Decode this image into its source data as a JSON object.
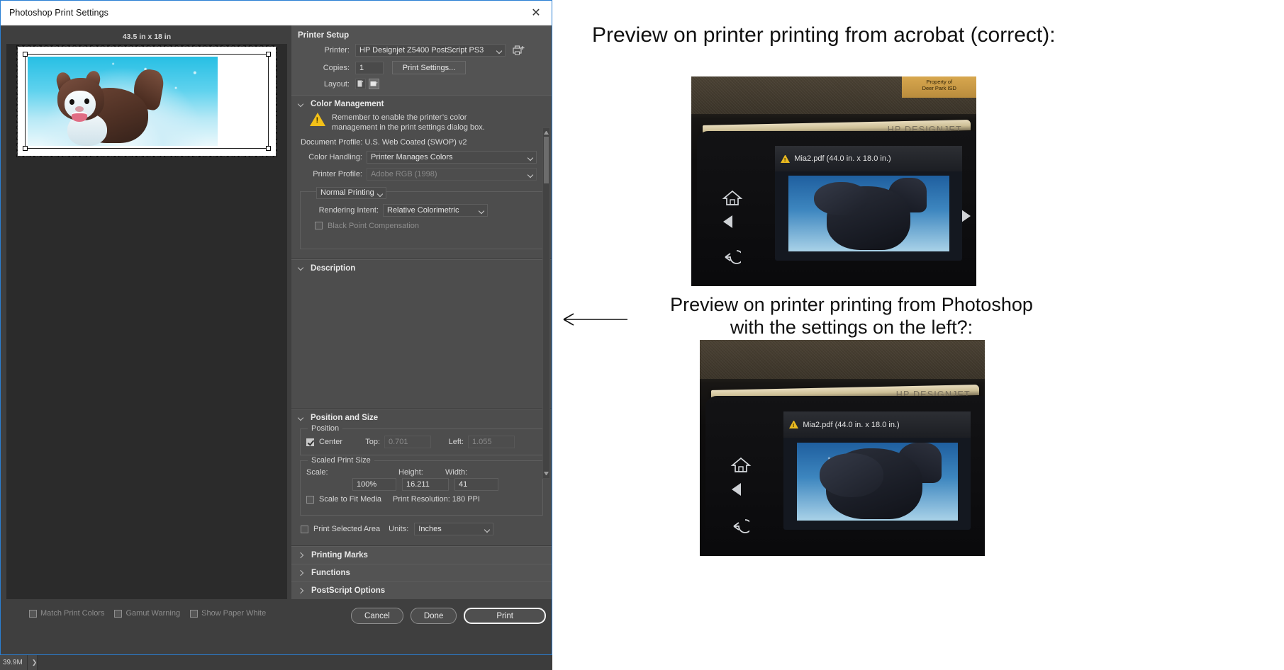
{
  "dialog": {
    "title": "Photoshop Print Settings",
    "close_icon": "close-icon"
  },
  "preview": {
    "size_label": "43.5 in x 18 in"
  },
  "printer_setup": {
    "heading": "Printer Setup",
    "printer_label": "Printer:",
    "printer_value": "HP Designjet Z5400 PostScript PS3",
    "printer_add_icon": "add-printer-icon",
    "copies_label": "Copies:",
    "copies_value": "1",
    "print_settings_button": "Print Settings...",
    "layout_label": "Layout:",
    "layout_portrait_icon": "portrait-orientation-icon",
    "layout_landscape_icon": "landscape-orientation-icon"
  },
  "color_management": {
    "heading": "Color Management",
    "warning_icon": "warning-triangle-icon",
    "warning_text_line1": "Remember to enable the printer’s color",
    "warning_text_line2": "management in the print settings dialog box.",
    "document_profile": "Document Profile: U.S. Web Coated (SWOP) v2",
    "color_handling_label": "Color Handling:",
    "color_handling_value": "Printer Manages Colors",
    "printer_profile_label": "Printer Profile:",
    "printer_profile_value": "Adobe RGB (1998)",
    "print_mode_value": "Normal Printing",
    "rendering_intent_label": "Rendering Intent:",
    "rendering_intent_value": "Relative Colorimetric",
    "black_point_label": "Black Point Compensation",
    "black_point_checked": false
  },
  "description": {
    "heading": "Description"
  },
  "position_size": {
    "heading": "Position and Size",
    "position_group": "Position",
    "center_label": "Center",
    "center_checked": true,
    "top_label": "Top:",
    "top_value": "0.701",
    "left_label": "Left:",
    "left_value": "1.055",
    "scaled_group": "Scaled Print Size",
    "scale_label": "Scale:",
    "scale_value": "100%",
    "height_label": "Height:",
    "height_value": "16.211",
    "width_label": "Width:",
    "width_value": "41",
    "scale_to_fit_label": "Scale to Fit Media",
    "scale_to_fit_checked": false,
    "print_resolution": "Print Resolution: 180 PPI",
    "print_selected_area_label": "Print Selected Area",
    "print_selected_area_checked": false,
    "units_label": "Units:",
    "units_value": "Inches"
  },
  "collapsed_sections": [
    {
      "label": "Printing Marks"
    },
    {
      "label": "Functions"
    },
    {
      "label": "PostScript Options"
    }
  ],
  "footer": {
    "match_print_colors": "Match Print Colors",
    "gamut_warning": "Gamut Warning",
    "show_paper_white": "Show Paper White",
    "cancel_button": "Cancel",
    "done_button": "Done",
    "print_button": "Print"
  },
  "status_bar": {
    "doc_size": "39.9M",
    "arrow_icon": "chevron-right-icon"
  },
  "annotations": {
    "note_top": "Preview on printer printing from acrobat (correct):",
    "note_bottom_line1": "Preview on printer printing from Photoshop",
    "note_bottom_line2": "with the settings on the left?:",
    "arrow_icon": "left-arrow-icon"
  },
  "printer_photos": [
    {
      "name": "printer-photo-acrobat",
      "brand": "HP DESIGNJET",
      "screen_title": "Mia2.pdf (44.0 in. x 18.0 in.)",
      "warning_icon": "warning-triangle-icon",
      "home_icon": "home-icon",
      "left_icon": "left-arrow-icon",
      "right_icon": "right-arrow-icon",
      "back_icon": "back-arrow-icon",
      "sticker_line1": "Property of",
      "sticker_line2": "Deer Park ISD"
    },
    {
      "name": "printer-photo-photoshop",
      "brand": "HP DESIGNJET",
      "screen_title": "Mia2.pdf (44.0 in. x 18.0 in.)",
      "warning_icon": "warning-triangle-icon",
      "home_icon": "home-icon",
      "left_icon": "left-arrow-icon",
      "back_icon": "back-arrow-icon"
    }
  ],
  "colors": {
    "accent": "#2a7fd4",
    "dialog_bg": "#3f3f3f",
    "panel_bg": "#4d4d4d",
    "warning": "#f2c018"
  }
}
